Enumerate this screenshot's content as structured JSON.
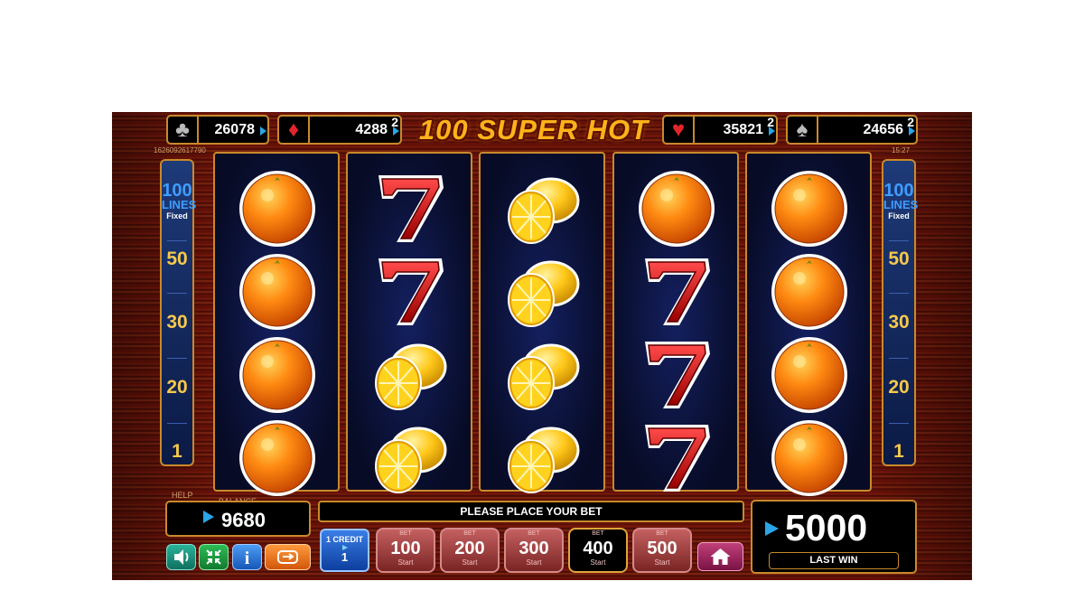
{
  "jackpots": [
    {
      "suit": "club",
      "value": "26078",
      "sup": ""
    },
    {
      "suit": "diamond",
      "value": "4288",
      "sup": "2"
    },
    {
      "suit": "heart",
      "value": "35821",
      "sup": "2"
    },
    {
      "suit": "spade",
      "value": "24656",
      "sup": "2"
    }
  ],
  "title": "100 SUPER HOT",
  "game_id": "1626092617790",
  "clock": "15:27",
  "lines_panel": {
    "count": "100",
    "lines_label": "LINES",
    "fixed_label": "Fixed",
    "numbers": [
      "50",
      "30",
      "20",
      "1"
    ]
  },
  "reels": [
    [
      "orange",
      "orange",
      "orange",
      "orange"
    ],
    [
      "seven",
      "seven",
      "lemon",
      "lemon"
    ],
    [
      "lemon",
      "lemon",
      "lemon",
      "lemon"
    ],
    [
      "orange",
      "seven",
      "seven",
      "seven"
    ],
    [
      "orange",
      "orange",
      "orange",
      "orange"
    ]
  ],
  "help_label": "HELP",
  "balance": {
    "label": "BALANCE",
    "value": "9680"
  },
  "message": "PLEASE PLACE YOUR BET",
  "credit": {
    "label": "1 CREDIT",
    "value": "1"
  },
  "bets": [
    {
      "label": "BET",
      "value": "100",
      "start": "Start",
      "selected": false
    },
    {
      "label": "BET",
      "value": "200",
      "start": "Start",
      "selected": false
    },
    {
      "label": "BET",
      "value": "300",
      "start": "Start",
      "selected": false
    },
    {
      "label": "BET",
      "value": "400",
      "start": "Start",
      "selected": true
    },
    {
      "label": "BET",
      "value": "500",
      "start": "Start",
      "selected": false
    }
  ],
  "last_win": {
    "value": "5000",
    "label": "LAST WIN"
  },
  "colors": {
    "frame": "#c9892b",
    "diamond_icon": "#2aa6e8",
    "lines_num": "#f6c84a"
  }
}
